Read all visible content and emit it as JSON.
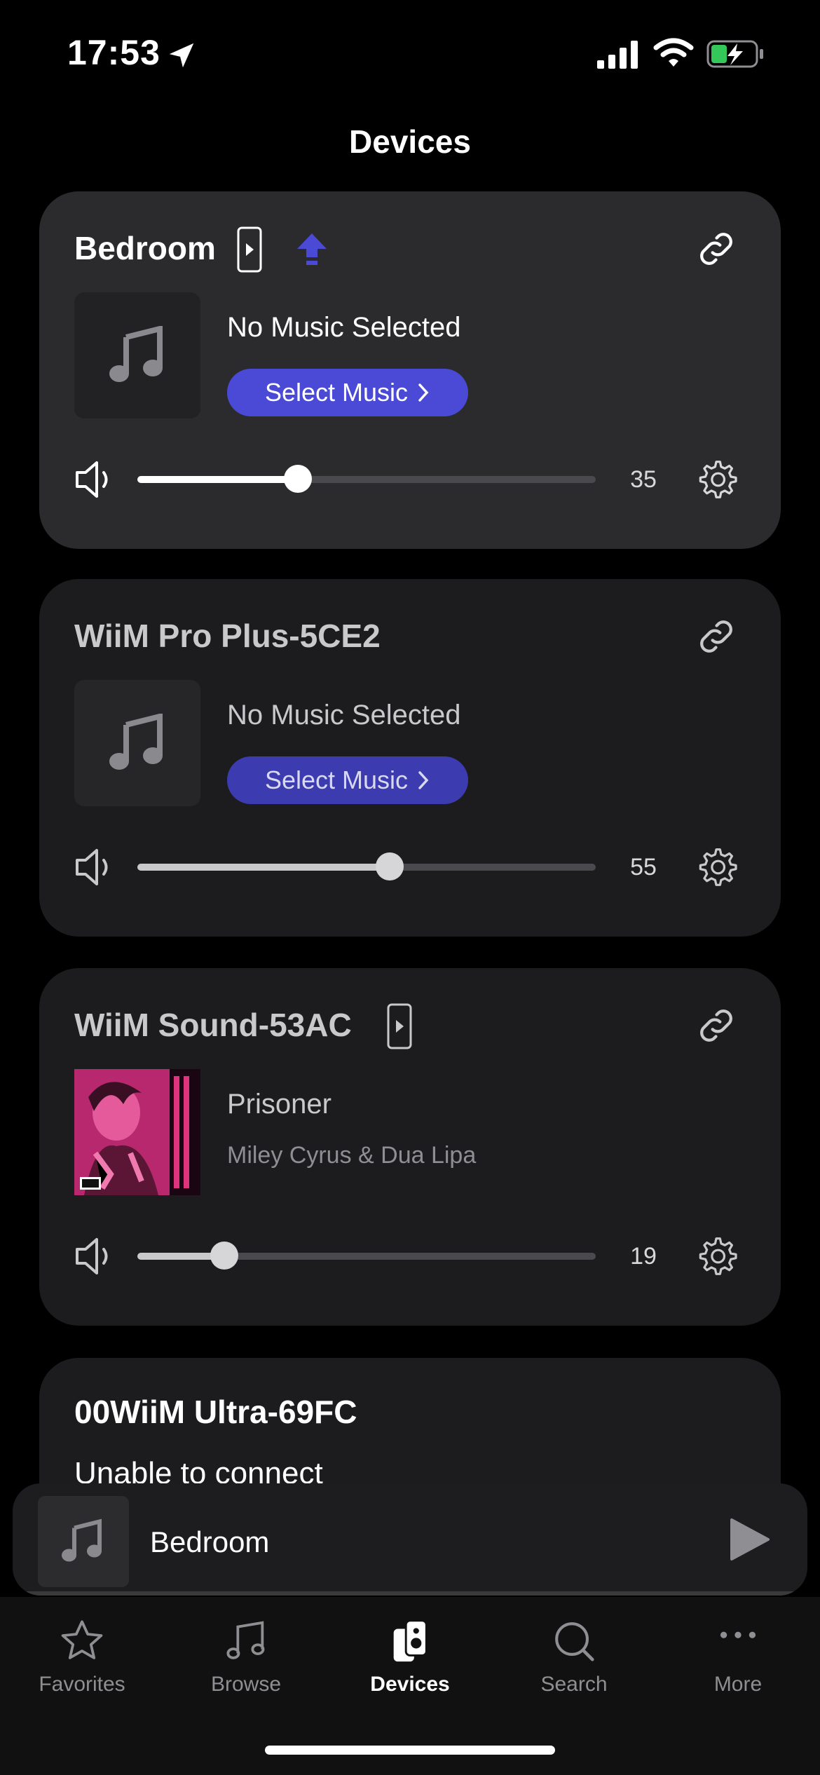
{
  "status": {
    "time": "17:53"
  },
  "header": {
    "title": "Devices"
  },
  "devices": [
    {
      "name": "Bedroom",
      "track_title": "No Music Selected",
      "select_label": "Select Music",
      "volume": "35",
      "volume_fraction": 0.35
    },
    {
      "name": "WiiM Pro Plus-5CE2",
      "track_title": "No Music Selected",
      "select_label": "Select Music",
      "volume": "55",
      "volume_fraction": 0.55
    },
    {
      "name": "WiiM Sound-53AC",
      "track_title": "Prisoner",
      "artist": "Miley Cyrus & Dua Lipa",
      "volume": "19",
      "volume_fraction": 0.19
    },
    {
      "name": "00WiiM Ultra-69FC",
      "status": "Unable to connect"
    }
  ],
  "mini_player": {
    "label": "Bedroom"
  },
  "tabs": [
    {
      "label": "Favorites",
      "icon": "star-icon"
    },
    {
      "label": "Browse",
      "icon": "music-note-icon"
    },
    {
      "label": "Devices",
      "icon": "speakers-icon",
      "active": true
    },
    {
      "label": "Search",
      "icon": "search-icon"
    },
    {
      "label": "More",
      "icon": "more-icon"
    }
  ],
  "colors": {
    "accent": "#4a4ad6",
    "background": "#000000",
    "card": "#1c1c1e",
    "card_active": "#2b2b2d"
  }
}
